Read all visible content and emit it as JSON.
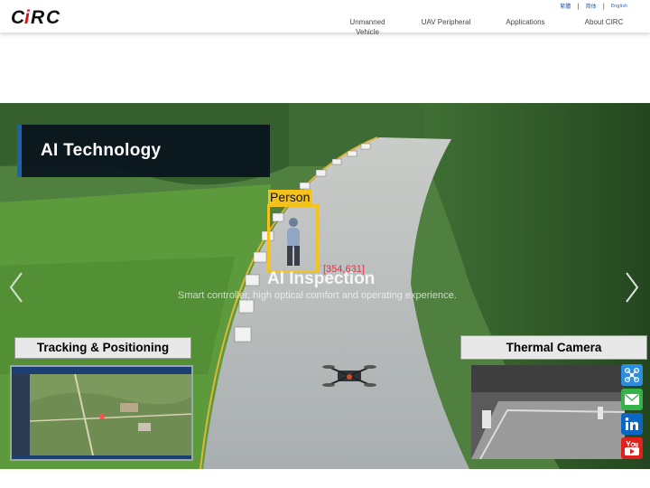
{
  "header": {
    "logo_text": "CIRC",
    "languages": [
      {
        "label": "繁體"
      },
      {
        "label": "简体"
      },
      {
        "label": "English"
      }
    ],
    "nav": [
      {
        "label_line1": "Unmanned",
        "label_line2": "Vehicle"
      },
      {
        "label": "UAV Peripheral"
      },
      {
        "label": "Applications"
      },
      {
        "label": "About CIRC"
      }
    ]
  },
  "hero": {
    "banner_title": "AI Technology",
    "detection_label": "Person",
    "detection_coords": "[354,631]",
    "slide_title": "AI Inspection",
    "slide_subtitle": "Smart controller, high optical comfort and operating experience.",
    "tracking_label": "Tracking & Positioning",
    "thermal_label": "Thermal Camera"
  },
  "social": [
    {
      "icon": "drone-icon",
      "color": "#2a8ee0"
    },
    {
      "icon": "mail-icon",
      "color": "#35b24a"
    },
    {
      "icon": "linkedin-icon",
      "color": "#0a66c2"
    },
    {
      "icon": "youtube-icon",
      "color": "#e0201a"
    }
  ],
  "colors": {
    "brand_red": "#d6101b",
    "banner_accent": "#1a63b0",
    "detection_yellow": "#f5c21a",
    "nav_link": "#1f5fbf"
  }
}
